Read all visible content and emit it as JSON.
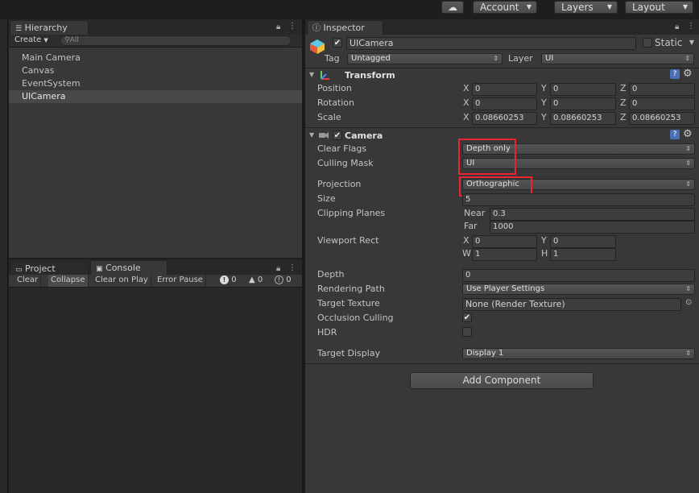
{
  "toolbar": {
    "cloud_icon": "cloud-icon",
    "account": "Account",
    "layers": "Layers",
    "layout": "Layout"
  },
  "hierarchy": {
    "tab": "Hierarchy",
    "create": "Create",
    "search_placeholder": "All",
    "items": [
      "Main Camera",
      "Canvas",
      "EventSystem",
      "UICamera"
    ],
    "selected": "UICamera"
  },
  "console": {
    "tabs": [
      "Project",
      "Console"
    ],
    "buttons": [
      "Clear",
      "Collapse",
      "Clear on Play",
      "Error Pause"
    ],
    "counts": {
      "info": "0",
      "warn": "0",
      "error": "0"
    }
  },
  "inspector": {
    "tab": "Inspector",
    "object_name": "UICamera",
    "static_label": "Static",
    "tag_label": "Tag",
    "tag_value": "Untagged",
    "layer_label": "Layer",
    "layer_value": "UI",
    "transform": {
      "title": "Transform",
      "position": {
        "label": "Position",
        "x": "0",
        "y": "0",
        "z": "0"
      },
      "rotation": {
        "label": "Rotation",
        "x": "0",
        "y": "0",
        "z": "0"
      },
      "scale": {
        "label": "Scale",
        "x": "0.08660253",
        "y": "0.08660253",
        "z": "0.08660253"
      }
    },
    "camera": {
      "title": "Camera",
      "clear_flags": {
        "label": "Clear Flags",
        "value": "Depth only"
      },
      "culling_mask": {
        "label": "Culling Mask",
        "value": "UI"
      },
      "projection": {
        "label": "Projection",
        "value": "Orthographic"
      },
      "size": {
        "label": "Size",
        "value": "5"
      },
      "clipping": {
        "label": "Clipping Planes",
        "near_label": "Near",
        "near": "0.3",
        "far_label": "Far",
        "far": "1000"
      },
      "viewport": {
        "label": "Viewport Rect",
        "x": "0",
        "y": "0",
        "w": "1",
        "h": "1"
      },
      "depth": {
        "label": "Depth",
        "value": "0"
      },
      "rendering_path": {
        "label": "Rendering Path",
        "value": "Use Player Settings"
      },
      "target_texture": {
        "label": "Target Texture",
        "value": "None (Render Texture)"
      },
      "occlusion_culling": {
        "label": "Occlusion Culling",
        "checked": true
      },
      "hdr": {
        "label": "HDR",
        "checked": false
      },
      "target_display": {
        "label": "Target Display",
        "value": "Display 1"
      }
    },
    "add_component": "Add Component"
  },
  "colors": {
    "highlight": "#e8262f",
    "selection": "#484848"
  }
}
